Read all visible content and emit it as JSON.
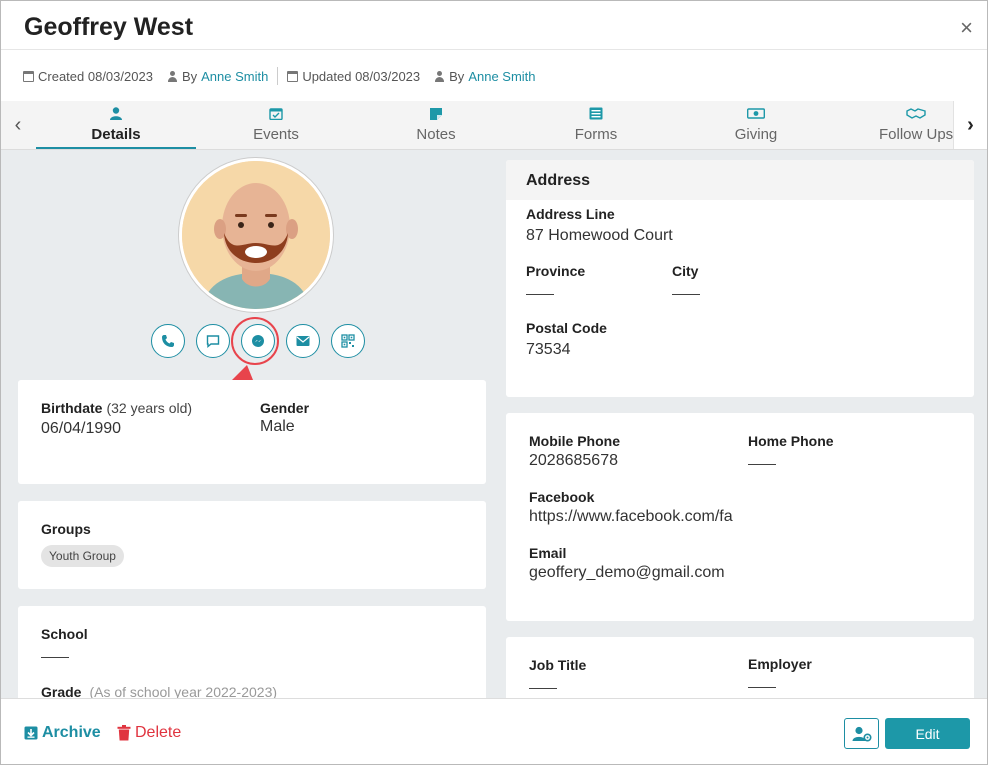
{
  "header": {
    "title": "Geoffrey West",
    "close_glyph": "×",
    "created": "Created 08/03/2023",
    "created_by_prefix": "By",
    "created_by": "Anne Smith",
    "updated": "Updated 08/03/2023",
    "updated_by_prefix": "By",
    "updated_by": "Anne Smith"
  },
  "tabs": [
    {
      "label": "Details",
      "icon": "person-icon",
      "active": true
    },
    {
      "label": "Events",
      "icon": "calendar-check-icon"
    },
    {
      "label": "Notes",
      "icon": "note-icon"
    },
    {
      "label": "Forms",
      "icon": "list-icon"
    },
    {
      "label": "Giving",
      "icon": "money-icon"
    },
    {
      "label": "Follow Ups",
      "icon": "handshake-icon"
    }
  ],
  "tab_nav": {
    "prev": "‹",
    "next": "›"
  },
  "contact_actions": [
    "phone-icon",
    "message-icon",
    "messenger-icon",
    "email-icon",
    "qr-code-icon"
  ],
  "profile": {
    "birthdate_label": "Birthdate",
    "birthdate_age": "(32 years old)",
    "birthdate": "06/04/1990",
    "gender_label": "Gender",
    "gender": "Male"
  },
  "groups": {
    "label": "Groups",
    "items": [
      "Youth Group"
    ]
  },
  "school": {
    "label": "School",
    "value": "——",
    "grade_label": "Grade",
    "grade_note": "(As of school year 2022-2023)"
  },
  "address": {
    "title": "Address",
    "line_label": "Address Line",
    "line": "87 Homewood Court",
    "province_label": "Province",
    "province": "——",
    "city_label": "City",
    "city": "——",
    "postal_label": "Postal Code",
    "postal": "73534"
  },
  "contact": {
    "mobile_label": "Mobile Phone",
    "mobile": "2028685678",
    "home_label": "Home Phone",
    "home": "——",
    "facebook_label": "Facebook",
    "facebook": "https://www.facebook.com/fa",
    "email_label": "Email",
    "email": "geoffery_demo@gmail.com"
  },
  "work": {
    "job_label": "Job Title",
    "job": "——",
    "employer_label": "Employer",
    "employer": "——"
  },
  "footer": {
    "archive": "Archive",
    "delete": "Delete",
    "edit": "Edit"
  },
  "colors": {
    "accent": "#1d8ea3",
    "danger": "#e0343f",
    "highlight": "#e8444c"
  }
}
